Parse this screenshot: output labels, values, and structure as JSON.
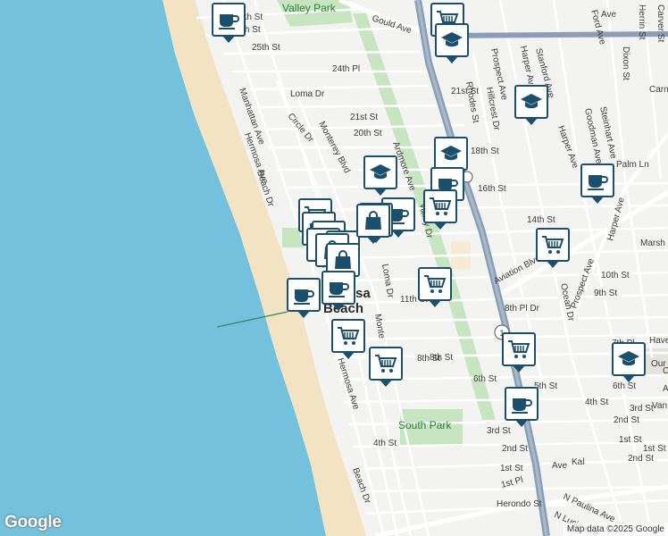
{
  "map": {
    "google_logo": "Google",
    "attribution": "Map data ©2025 Google",
    "route_shield": "1",
    "city_label_lines": [
      "sa",
      "Beach"
    ],
    "park_labels": [
      "Valley Park",
      "South Park"
    ],
    "street_labels": [
      "7th St",
      "26th St",
      "25th St",
      "Gould Ave",
      "24th Pl",
      "Manhattan Ave",
      "Loma Dr",
      "21st St",
      "20th St",
      "Circle Dr",
      "Monterey Blvd",
      "Ardmore Ave",
      "18th St",
      "Hermosa Ave",
      "Beach Dr",
      "16th St",
      "14th St",
      "Valley Dr",
      "Aviation Blvd",
      "10th St",
      "9th St",
      "Loma Dr",
      "11th St",
      "8th Pl Dr",
      "Ocean Dr",
      "Prospect Ave",
      "Harper Ave",
      "Marsh",
      "8th St",
      "6th St",
      "Monte",
      "Hermosa Ave",
      "4th St",
      "5th St",
      "3rd St",
      "2nd St",
      "1st St",
      "Herondo St",
      "1st Pl",
      "N Paulina Ave",
      "N Lucia Ave",
      "Beach Dr",
      "7th Pl",
      "6th St",
      "Have",
      "Van",
      "Dixon St",
      "Herrin St",
      "Carver St",
      "Carnegie Ln",
      "Stanford Ave",
      "Ford Ave",
      "Steinhart Ave",
      "Goodman Ave",
      "Palm Ln",
      "Rhodes St",
      "Hillcrest Dr",
      "21st St",
      "Prospect Ave",
      "Harper Ave",
      "Harper Ave",
      "Our",
      "Chur",
      "A",
      "6th St",
      "2nd St",
      "1st St",
      "1st St",
      "4th St",
      "3rd St",
      "2nd St",
      "Ave",
      "Kal",
      "Ave",
      "8th St"
    ],
    "markers": [
      {
        "type": "cafe"
      },
      {
        "type": "grocery"
      },
      {
        "type": "school"
      },
      {
        "type": "school"
      },
      {
        "type": "school"
      },
      {
        "type": "school"
      },
      {
        "type": "cafe"
      },
      {
        "type": "cafe"
      },
      {
        "type": "grocery"
      },
      {
        "type": "grocery"
      },
      {
        "type": "cafe"
      },
      {
        "type": "grocery"
      },
      {
        "type": "cafe"
      },
      {
        "type": "grocery"
      },
      {
        "type": "shopping"
      },
      {
        "type": "shopping"
      },
      {
        "type": "shopping"
      },
      {
        "type": "shopping"
      },
      {
        "type": "shopping"
      },
      {
        "type": "grocery"
      },
      {
        "type": "grocery"
      },
      {
        "type": "cafe"
      },
      {
        "type": "cafe"
      },
      {
        "type": "grocery"
      },
      {
        "type": "grocery"
      },
      {
        "type": "grocery"
      },
      {
        "type": "cafe"
      },
      {
        "type": "school"
      }
    ]
  },
  "colors": {
    "ocean": "#73c1dc",
    "sand": "#f2e4c2",
    "land": "#f3f3f1",
    "park": "#c6e5c0",
    "highway": "#8a9fb5",
    "pin_border": "#1b4f6b"
  }
}
